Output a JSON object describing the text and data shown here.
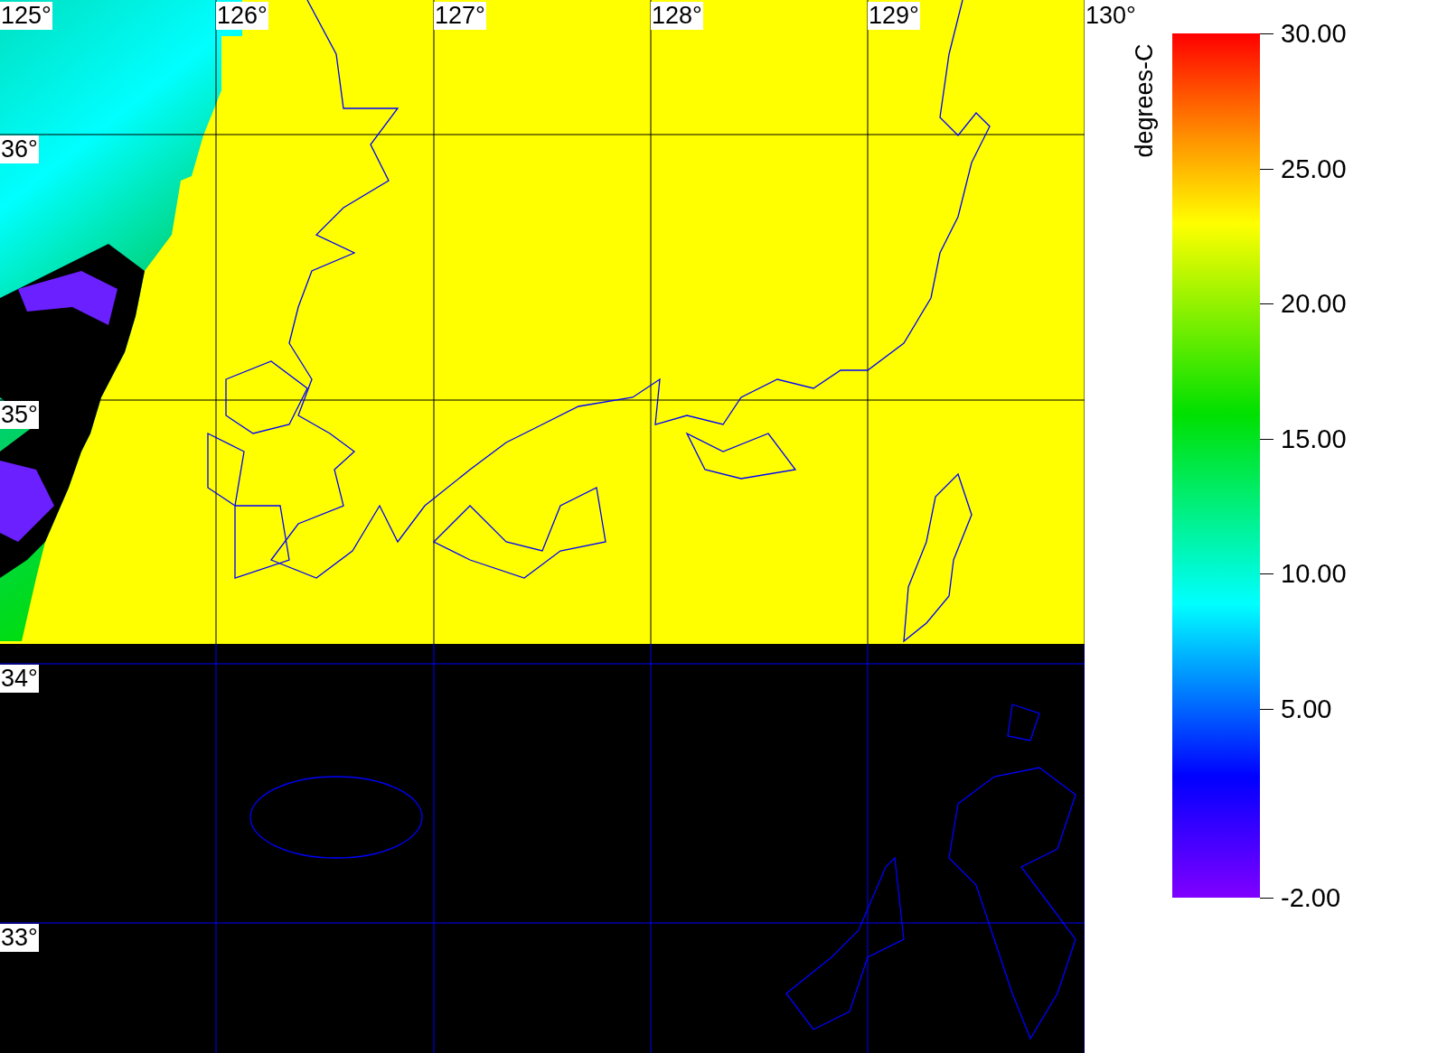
{
  "map": {
    "longitude_labels": [
      "125°",
      "126°",
      "127°",
      "128°",
      "129°",
      "130°"
    ],
    "latitude_labels": [
      "36°",
      "35°",
      "34°",
      "33°"
    ]
  },
  "color_bar": {
    "title": "degrees-C",
    "ticks": [
      "30.00",
      "25.00",
      "20.00",
      "15.00",
      "10.00",
      "5.00",
      "-2.00"
    ]
  }
}
